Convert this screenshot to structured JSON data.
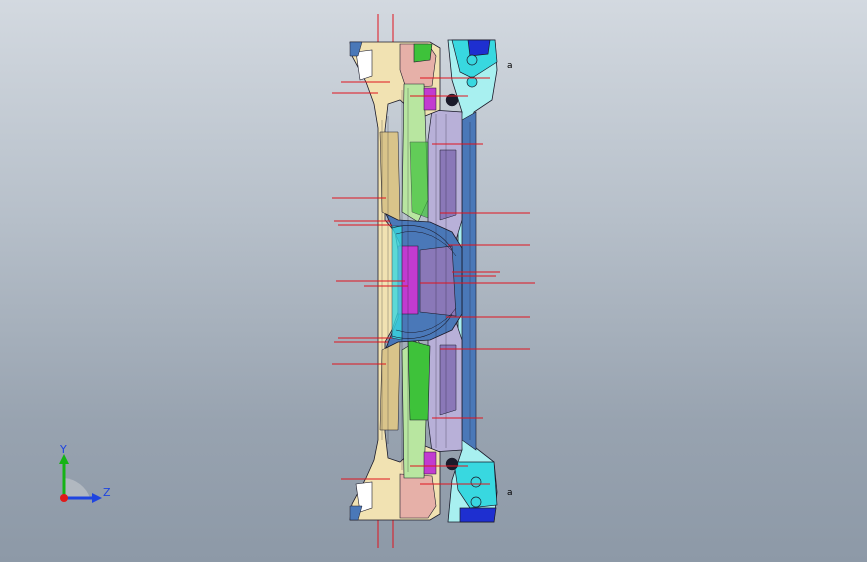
{
  "viewport": {
    "background_top": "#d3d9e0",
    "background_bottom": "#8d99a7"
  },
  "triad": {
    "y_label": "Y",
    "z_label": "Z",
    "y_color": "#16b316",
    "z_color": "#1f45e0",
    "x_color": "#e01a1a",
    "axis_label_color": "#1f45e0"
  },
  "model": {
    "leader_line_color": "#e0141e",
    "outline_color": "#1a1a2a",
    "part_colors": {
      "cream": "#f1e2b2",
      "tan": "#d9c48a",
      "light_green": "#b8e6a0",
      "green": "#3ec23a",
      "magenta": "#c23bd0",
      "violet": "#8a78b8",
      "lavender": "#b8b0d8",
      "steel_blue": "#4a78b8",
      "cyan": "#38d8e0",
      "light_cyan": "#a8f0f0",
      "blue": "#1e2fd0",
      "pink": "#e6b0a8"
    },
    "markers": [
      "a",
      "a"
    ]
  }
}
